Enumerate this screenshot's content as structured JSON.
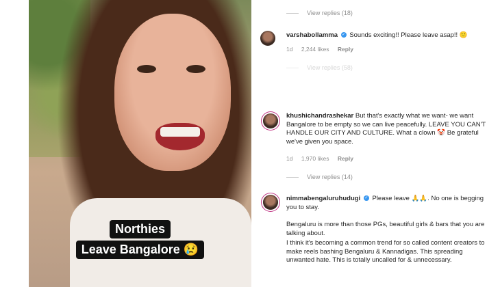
{
  "video": {
    "caption_line1": "Northies",
    "caption_line2": "Leave Bangalore",
    "caption_emoji": "😢"
  },
  "comments": [
    {
      "view_replies_above": "View replies (18)",
      "username": "varshabollamma",
      "verified": true,
      "text": "Sounds exciting!! Please leave asap!! 🙂",
      "age": "1d",
      "likes": "2,244 likes",
      "reply": "Reply",
      "view_replies": "View replies (58)"
    },
    {
      "username": "khushichandrashekar",
      "verified": false,
      "text": "But that's exactly what we want- we want Bangalore to be empty so we can live peacefully. LEAVE YOU CAN'T HANDLE OUR CITY AND CULTURE. What a clown 🤡 Be grateful we've given you space.",
      "age": "1d",
      "likes": "1,970 likes",
      "reply": "Reply",
      "view_replies": "View replies (14)"
    },
    {
      "username": "nimmabengaluruhudugi",
      "verified": true,
      "text_line1": "Please leave 🙏🙏. No one is begging you to stay.",
      "text_para2": "Bengaluru is more than those PGs, beautiful girls & bars that you are talking about.",
      "text_para3": "I think it's becoming a common trend for so called content creators to make reels bashing Bengaluru & Kannadigas. This spreading unwanted hate. This is totally uncalled for & unnecessary."
    }
  ]
}
